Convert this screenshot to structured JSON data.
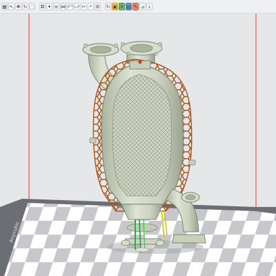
{
  "app": {
    "title": ""
  },
  "toolbar": {
    "groups": [
      {
        "buttons": [
          {
            "icon": "grid-view-icon",
            "glyph": "▦"
          },
          {
            "icon": "cursor-icon",
            "glyph": "↖"
          },
          {
            "icon": "arrow-move-icon",
            "glyph": "✥"
          },
          {
            "icon": "rotate-icon",
            "glyph": "↻"
          },
          {
            "icon": "select-box-icon",
            "glyph": "⬚"
          }
        ]
      },
      {
        "buttons": [
          {
            "icon": "view-icon",
            "glyph": "⌘"
          },
          {
            "icon": "light-bulb-icon",
            "glyph": "✦"
          },
          {
            "icon": "layer-icon",
            "glyph": "≡"
          },
          {
            "icon": "wire-icon",
            "glyph": "⋈"
          },
          {
            "icon": "undo-icon",
            "glyph": "⤺"
          },
          {
            "icon": "redo-icon",
            "glyph": "⤻"
          },
          {
            "icon": "cut-icon",
            "glyph": "✂"
          },
          {
            "icon": "zoom-icon",
            "glyph": "⌕"
          },
          {
            "icon": "settings-icon",
            "glyph": "⚙"
          }
        ]
      },
      {
        "buttons": [
          {
            "icon": "refresh-icon",
            "glyph": "↻"
          },
          {
            "icon": "mesh-support-icon",
            "glyph": "▣",
            "style": "colored1"
          },
          {
            "icon": "support-tree-icon",
            "glyph": "✳",
            "style": "colored2"
          },
          {
            "icon": "slice-icon",
            "glyph": "▧",
            "style": "colored3"
          },
          {
            "icon": "fix-icon",
            "glyph": "✎",
            "style": "colored4"
          },
          {
            "icon": "measure-icon",
            "glyph": "⊿"
          },
          {
            "icon": "export-icon",
            "glyph": "⤓"
          }
        ]
      }
    ]
  },
  "scene": {
    "colors": {
      "background": "#e6e7e9",
      "build_plate_light": "#ffffff",
      "build_plate_dark": "#c8c8cc",
      "plate_frame": "#6b6e72",
      "model": "#ccd5c2",
      "model_dark": "#9aa38f",
      "support_lattice": "#a8551c",
      "boundary_line": "#ff2a2a"
    },
    "plate_label": "Anycubic"
  }
}
